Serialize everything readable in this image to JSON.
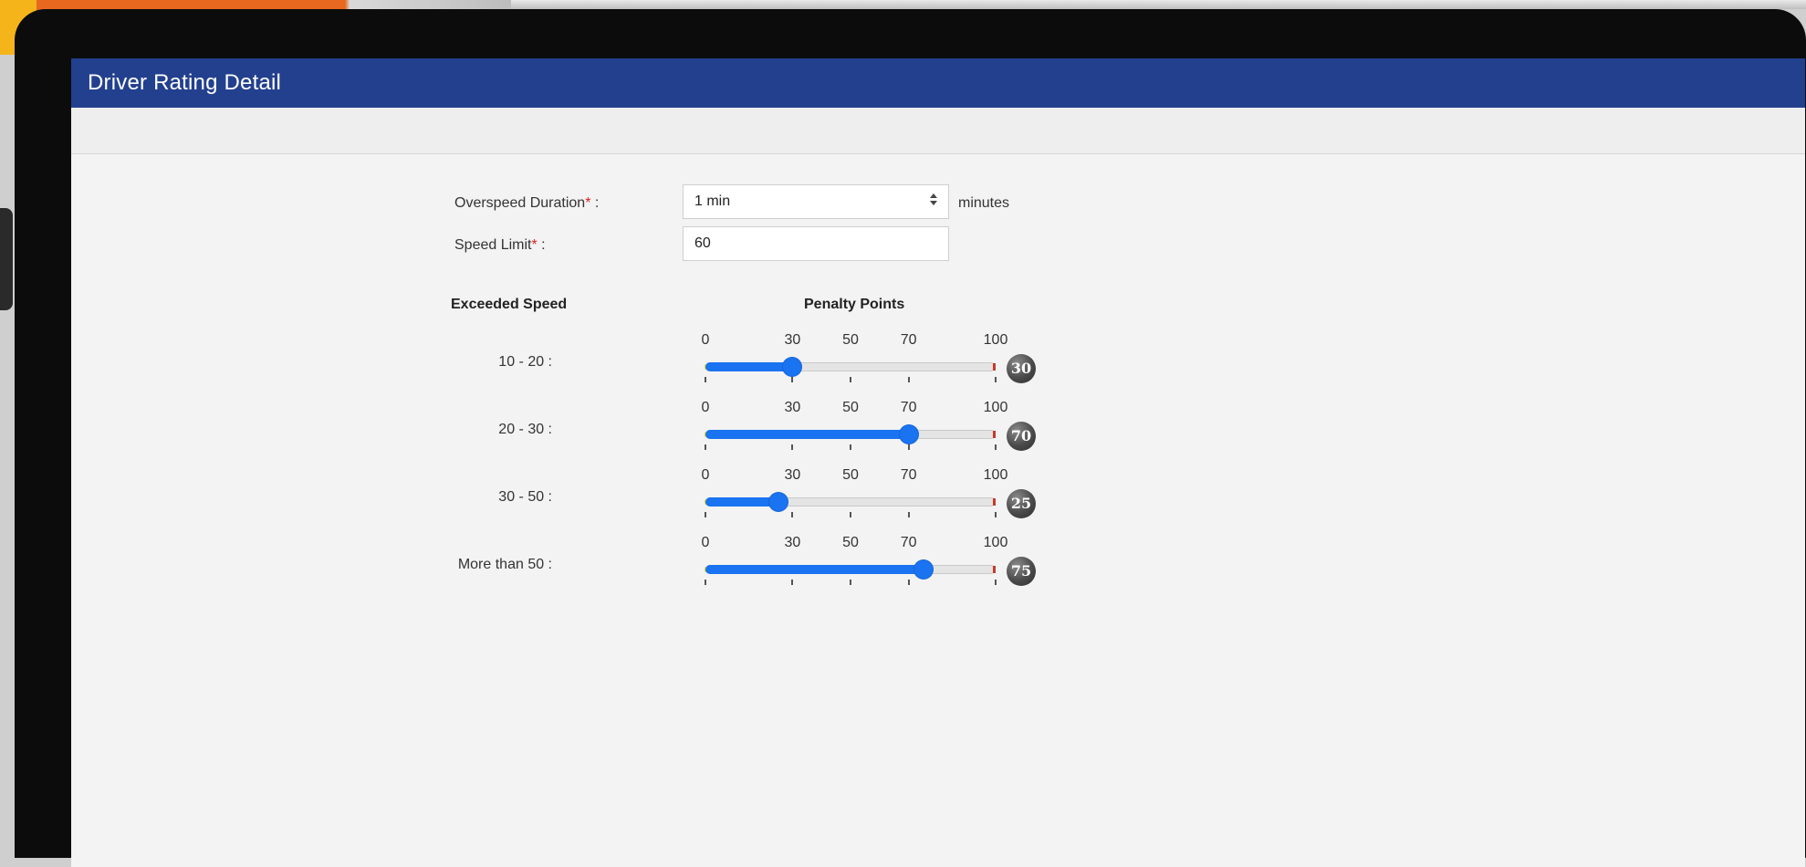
{
  "window": {
    "title": "Driver Rating Detail"
  },
  "form": {
    "overspeed": {
      "label": "Overspeed Duration",
      "required_mark": "*",
      "suffix": " :",
      "value": "1 min",
      "unit": "minutes"
    },
    "speed_limit": {
      "label": "Speed Limit",
      "required_mark": "*",
      "suffix": " :",
      "value": "60"
    }
  },
  "headers": {
    "exceeded_speed": "Exceeded Speed",
    "penalty_points": "Penalty Points"
  },
  "scale": {
    "min": 0,
    "max": 100,
    "ticks": [
      {
        "value": 0,
        "label": "0"
      },
      {
        "value": 30,
        "label": "30"
      },
      {
        "value": 50,
        "label": "50"
      },
      {
        "value": 70,
        "label": "70"
      },
      {
        "value": 100,
        "label": "100"
      }
    ]
  },
  "sliders": [
    {
      "range_label": "10 - 20 :",
      "value": 30,
      "badge": "30"
    },
    {
      "range_label": "20 - 30 :",
      "value": 70,
      "badge": "70"
    },
    {
      "range_label": "30 - 50 :",
      "value": 25,
      "badge": "25"
    },
    {
      "range_label": "More than 50 :",
      "value": 75,
      "badge": "75"
    }
  ],
  "colors": {
    "titlebar": "#23408f",
    "slider_fill": "#1a73f0",
    "required": "#e02020"
  }
}
